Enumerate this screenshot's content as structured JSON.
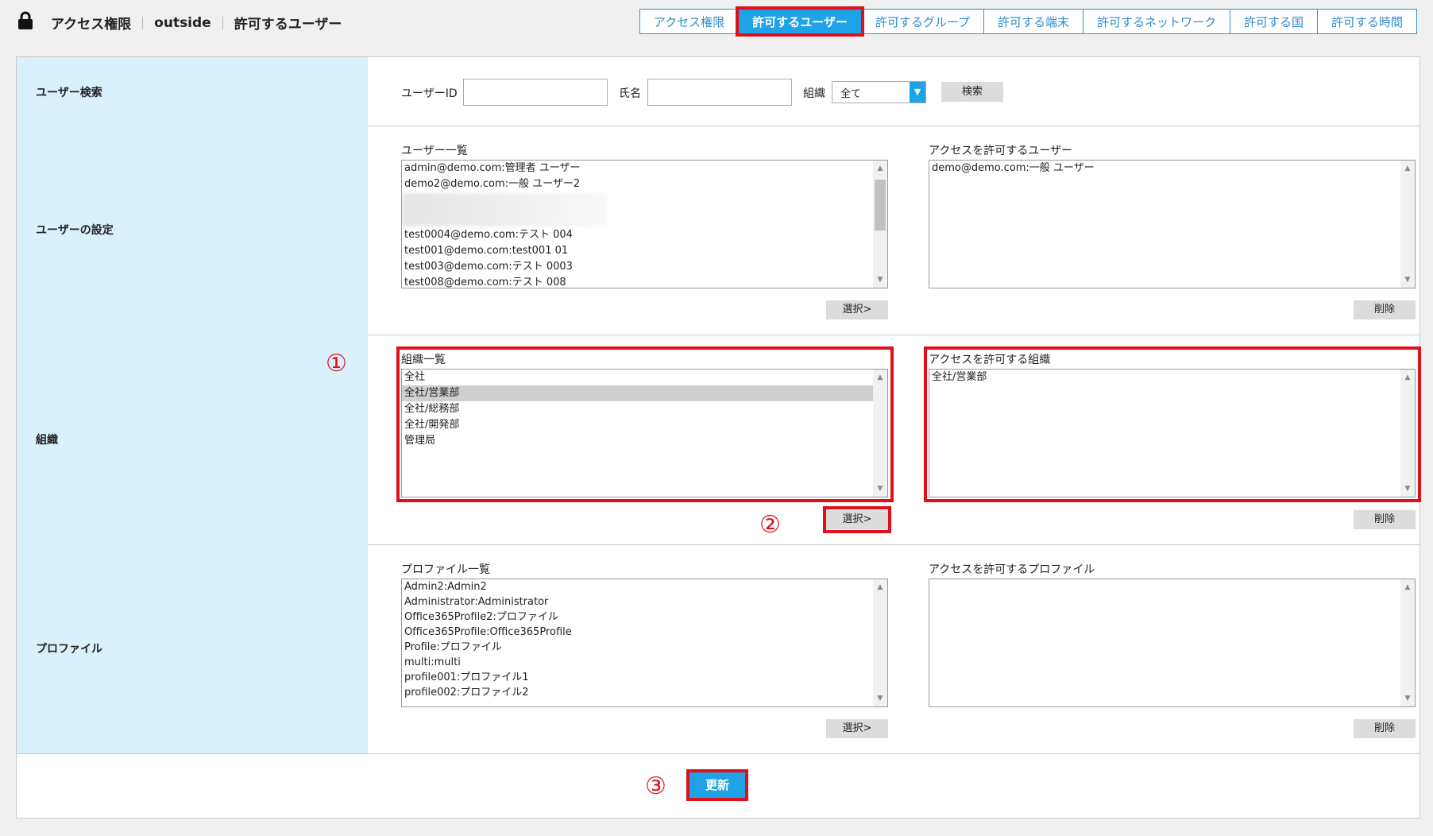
{
  "header": {
    "crumbs": [
      "アクセス権限",
      "outside",
      "許可するユーザー"
    ],
    "tabs": [
      {
        "label": "アクセス権限",
        "active": false
      },
      {
        "label": "許可するユーザー",
        "active": true
      },
      {
        "label": "許可するグループ",
        "active": false
      },
      {
        "label": "許可する端末",
        "active": false
      },
      {
        "label": "許可するネットワーク",
        "active": false
      },
      {
        "label": "許可する国",
        "active": false
      },
      {
        "label": "許可する時間",
        "active": false
      }
    ]
  },
  "search": {
    "label": "ユーザー検索",
    "user_id_label": "ユーザーID",
    "user_id_value": "",
    "name_label": "氏名",
    "name_value": "",
    "org_label": "組織",
    "org_selected": "全て",
    "search_button": "検索"
  },
  "user_settings": {
    "label": "ユーザーの設定",
    "list_title": "ユーザー一覧",
    "list_items": [
      "admin@demo.com:管理者 ユーザー",
      "demo2@demo.com:一般 ユーザー2",
      "",
      "test0004@demo.com:テスト 004",
      "test001@demo.com:test001 01",
      "test003@demo.com:テスト 0003",
      "test008@demo.com:テスト 008"
    ],
    "allowed_title": "アクセスを許可するユーザー",
    "allowed_items": [
      "demo@demo.com:一般 ユーザー"
    ],
    "select_button": "選択>",
    "delete_button": "削除"
  },
  "organization": {
    "label": "組織",
    "list_title": "組織一覧",
    "list_items": [
      "全社",
      "全社/営業部",
      "全社/総務部",
      "全社/開発部",
      "管理局"
    ],
    "selected_index": 1,
    "allowed_title": "アクセスを許可する組織",
    "allowed_items": [
      "全社/営業部"
    ],
    "select_button": "選択>",
    "delete_button": "削除"
  },
  "profile": {
    "label": "プロファイル",
    "list_title": "プロファイル一覧",
    "list_items": [
      "Admin2:Admin2",
      "Administrator:Administrator",
      "Office365Profile2:プロファイル",
      "Office365Profile:Office365Profile",
      "Profile:プロファイル",
      "multi:multi",
      "profile001:プロファイル1",
      "profile002:プロファイル2"
    ],
    "allowed_title": "アクセスを許可するプロファイル",
    "allowed_items": [],
    "select_button": "選択>",
    "delete_button": "削除"
  },
  "annotations": {
    "one": "①",
    "two": "②",
    "three": "③"
  },
  "update_button": "更新",
  "colors": {
    "accent": "#1fa2e6",
    "highlight": "#e0101a",
    "label_bg": "#d9f0fd"
  }
}
